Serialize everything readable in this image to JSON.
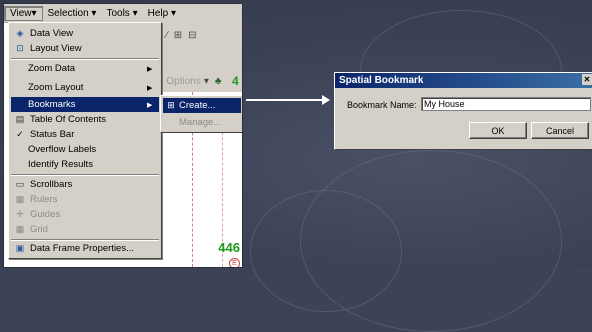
{
  "menubar": {
    "items": [
      "View▾",
      "Selection ▾",
      "Tools ▾",
      "Help ▾"
    ]
  },
  "view_menu": {
    "items": [
      {
        "label": "Data View",
        "icon": "data-view-icon",
        "glyph": "◈"
      },
      {
        "label": "Layout View",
        "icon": "layout-view-icon",
        "glyph": "⊡"
      },
      {
        "label": "Zoom Data",
        "submenu": true
      },
      {
        "label": "Zoom Layout",
        "submenu": true
      },
      {
        "label": "Bookmarks",
        "submenu": true,
        "selected": true
      },
      {
        "label": "Table Of Contents",
        "icon": "table-of-contents-icon",
        "glyph": "▤"
      },
      {
        "label": "Status Bar",
        "icon": "check-icon",
        "glyph": "✓"
      },
      {
        "label": "Overflow Labels"
      },
      {
        "label": "Identify Results"
      },
      {
        "label": "Scrollbars",
        "icon": "scrollbars-icon",
        "glyph": "▭"
      },
      {
        "label": "Rulers",
        "icon": "rulers-icon",
        "glyph": "▦",
        "disabled": true
      },
      {
        "label": "Guides",
        "icon": "guides-icon",
        "glyph": "✛",
        "disabled": true
      },
      {
        "label": "Grid",
        "icon": "grid-icon",
        "glyph": "▦",
        "disabled": true
      },
      {
        "label": "Data Frame Properties...",
        "icon": "properties-icon",
        "glyph": "▣"
      }
    ]
  },
  "bookmarks_submenu": {
    "create": "Create...",
    "manage": "Manage..."
  },
  "toolbar": {
    "options_label": "Options"
  },
  "map": {
    "label": "446",
    "marker": "E"
  },
  "dialog": {
    "title": "Spatial Bookmark",
    "field_label": "Bookmark Name:",
    "field_value": "My House",
    "ok_label": "OK",
    "cancel_label": "Cancel"
  },
  "colors": {
    "highlight": "#0a246a",
    "menu_bg": "#d4d0c8",
    "slide_bg": "#3d4356"
  }
}
